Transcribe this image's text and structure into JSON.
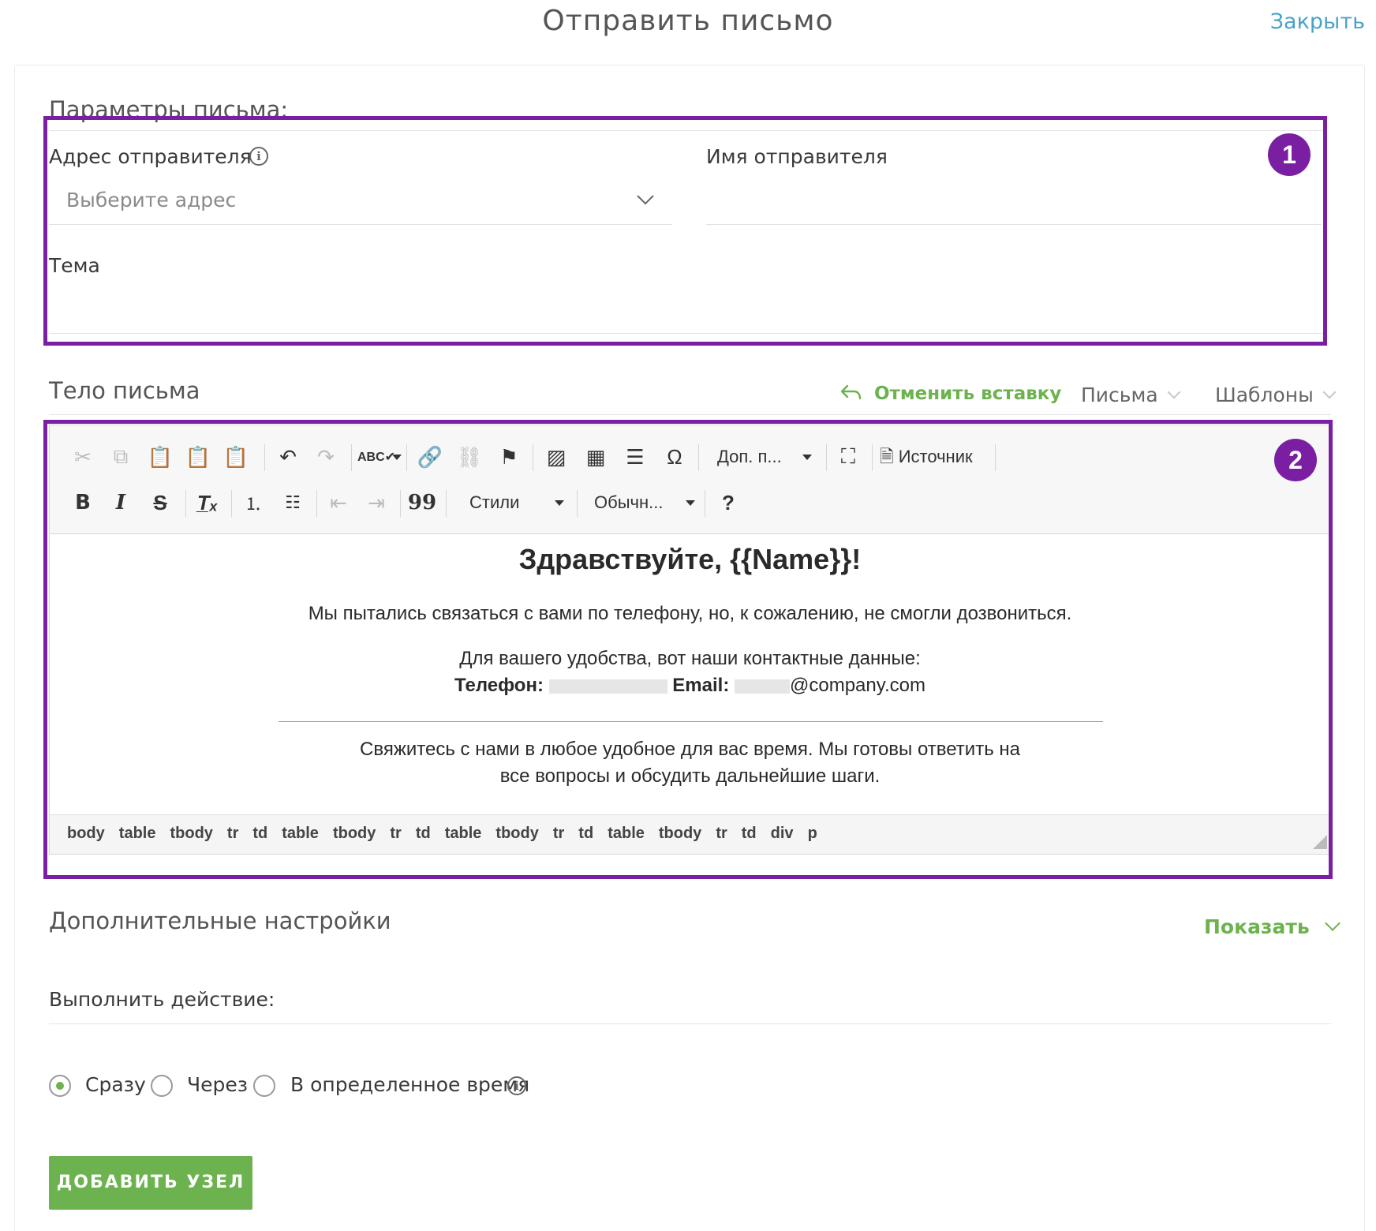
{
  "header": {
    "title": "Отправить письмо",
    "close_label": "Закрыть"
  },
  "params": {
    "title": "Параметры письма:",
    "sender_address_label": "Адрес отправителя",
    "sender_address_placeholder": "Выберите адрес",
    "sender_name_label": "Имя отправителя",
    "subject_label": "Тема",
    "badge": "1"
  },
  "body_section": {
    "title": "Тело письма",
    "undo_insert_label": "Отменить вставку",
    "letters_label": "Письма",
    "templates_label": "Шаблоны",
    "badge": "2"
  },
  "toolbar": {
    "more_label": "Доп. п...",
    "source_label": "Источник",
    "styles_label": "Стили",
    "format_label": "Обычн...",
    "bold": "B",
    "italic": "I",
    "strike": "S",
    "quote": "99",
    "help": "?"
  },
  "email": {
    "greeting": "Здравствуйте, {{Name}}!",
    "line1": "Мы пытались связаться с вами по телефону, но, к сожалению, не смогли дозвониться.",
    "line2": "Для вашего удобства, вот наши контактные данные:",
    "phone_label": "Телефон:",
    "email_label": "Email:",
    "email_domain": "@company.com",
    "line3a": "Свяжитесь с нами в любое удобное для вас время. Мы готовы ответить на",
    "line3b": "все вопросы и обсудить дальнейшие шаги."
  },
  "path": [
    "body",
    "table",
    "tbody",
    "tr",
    "td",
    "table",
    "tbody",
    "tr",
    "td",
    "table",
    "tbody",
    "tr",
    "td",
    "table",
    "tbody",
    "tr",
    "td",
    "div",
    "p"
  ],
  "extra": {
    "title": "Дополнительные настройки",
    "show_label": "Показать",
    "action_label": "Выполнить действие:",
    "radio_now": "Сразу",
    "radio_after": "Через",
    "radio_at_time": "В определенное время",
    "selected": "Сразу"
  },
  "add_button_label": "ДОБАВИТЬ УЗЕЛ",
  "colors": {
    "accent_green": "#6cb24f",
    "highlight_purple": "#7a1fa2",
    "link_blue": "#4aa3c7"
  }
}
